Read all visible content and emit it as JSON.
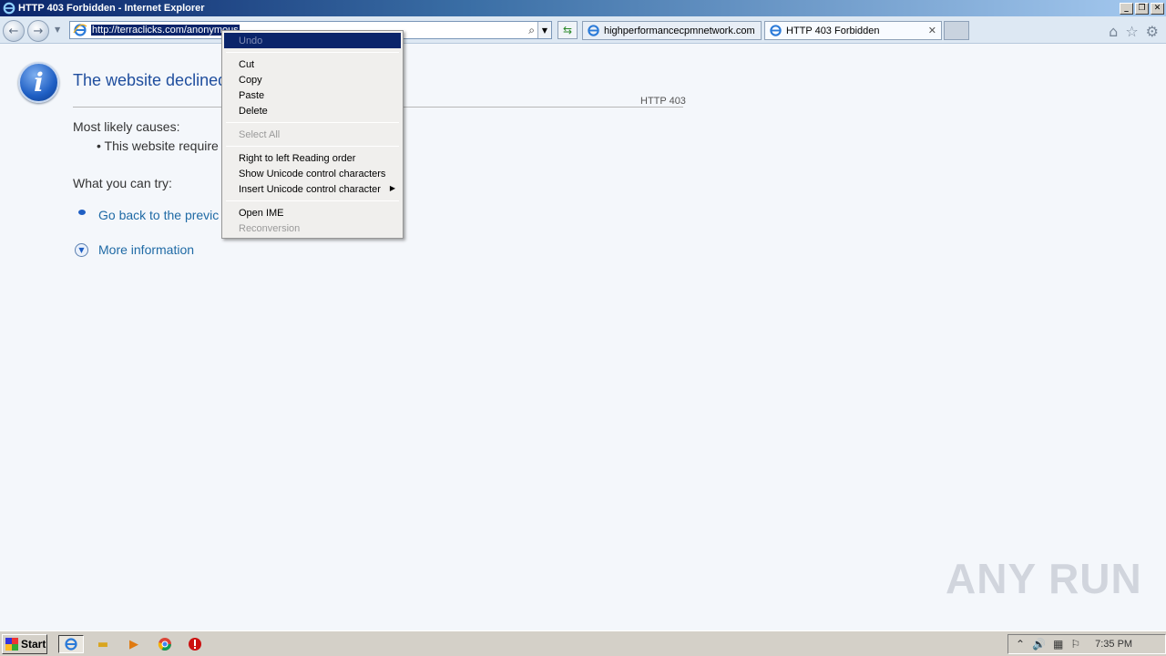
{
  "window": {
    "title": "HTTP 403 Forbidden - Internet Explorer",
    "min": "_",
    "max": "❐",
    "close": "✕"
  },
  "nav": {
    "back_glyph": "←",
    "fwd_glyph": "→",
    "dropdown_glyph": "▼",
    "address": "http://terraclicks.com/anonymous",
    "search_glyph": "⌕",
    "address_dropdown_glyph": "▼",
    "refresh_glyph": "⇆"
  },
  "tabs": [
    {
      "label": "highperformancecpmnetwork.com"
    },
    {
      "label": "HTTP 403 Forbidden",
      "close": "✕"
    }
  ],
  "toolbar": {
    "home": "⌂",
    "favorites": "☆",
    "tools": "⚙"
  },
  "page": {
    "info_glyph": "i",
    "heading": "The website declined",
    "code": "HTTP 403",
    "causes_label": "Most likely causes:",
    "cause_item": "•  This website require",
    "try_label": "What you can try:",
    "go_back": "Go back to the previc",
    "more_glyph": "▼",
    "more_info": "More information"
  },
  "context_menu": {
    "items": [
      {
        "label": "Undo",
        "state": "highlighted-disabled"
      },
      {
        "label": "Cut"
      },
      {
        "label": "Copy"
      },
      {
        "label": "Paste"
      },
      {
        "label": "Delete"
      },
      {
        "label": "Select All",
        "state": "disabled"
      },
      {
        "label": "Right to left Reading order"
      },
      {
        "label": "Show Unicode control characters"
      },
      {
        "label": "Insert Unicode control character",
        "submenu": "▶"
      },
      {
        "label": "Open IME"
      },
      {
        "label": "Reconversion",
        "state": "disabled"
      }
    ]
  },
  "watermark": "ANY RUN",
  "taskbar": {
    "start": "Start",
    "ie_glyph": "e",
    "folder_glyph": "▬",
    "media_glyph": "▶",
    "chrome_glyph": "◉",
    "stop_glyph": "●",
    "tray_up": "⌃",
    "tray_volume": "🔊",
    "tray_network": "▦",
    "tray_flag": "⚐",
    "clock": "7:35 PM"
  },
  "colors": {
    "title_bar": "#0a246a",
    "link": "#1f6aa5",
    "heading": "#1f4e9e",
    "menu_highlight": "#0a246a"
  }
}
